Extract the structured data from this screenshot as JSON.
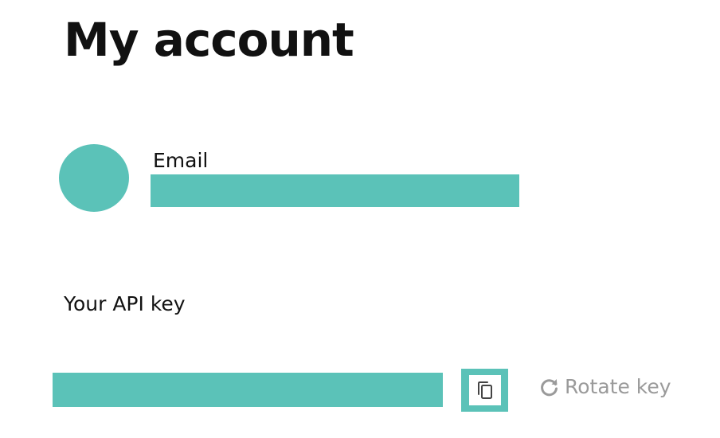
{
  "page": {
    "title": "My account"
  },
  "profile": {
    "email_label": "Email",
    "email_value": ""
  },
  "api": {
    "label": "Your API key",
    "key_value": "",
    "rotate_label": "Rotate key"
  },
  "icons": {
    "copy": "copy-icon",
    "rotate": "rotate-icon"
  },
  "colors": {
    "accent": "#5bc2b8",
    "text": "#111111",
    "muted": "#9a9a9a",
    "icon": "#444444"
  }
}
